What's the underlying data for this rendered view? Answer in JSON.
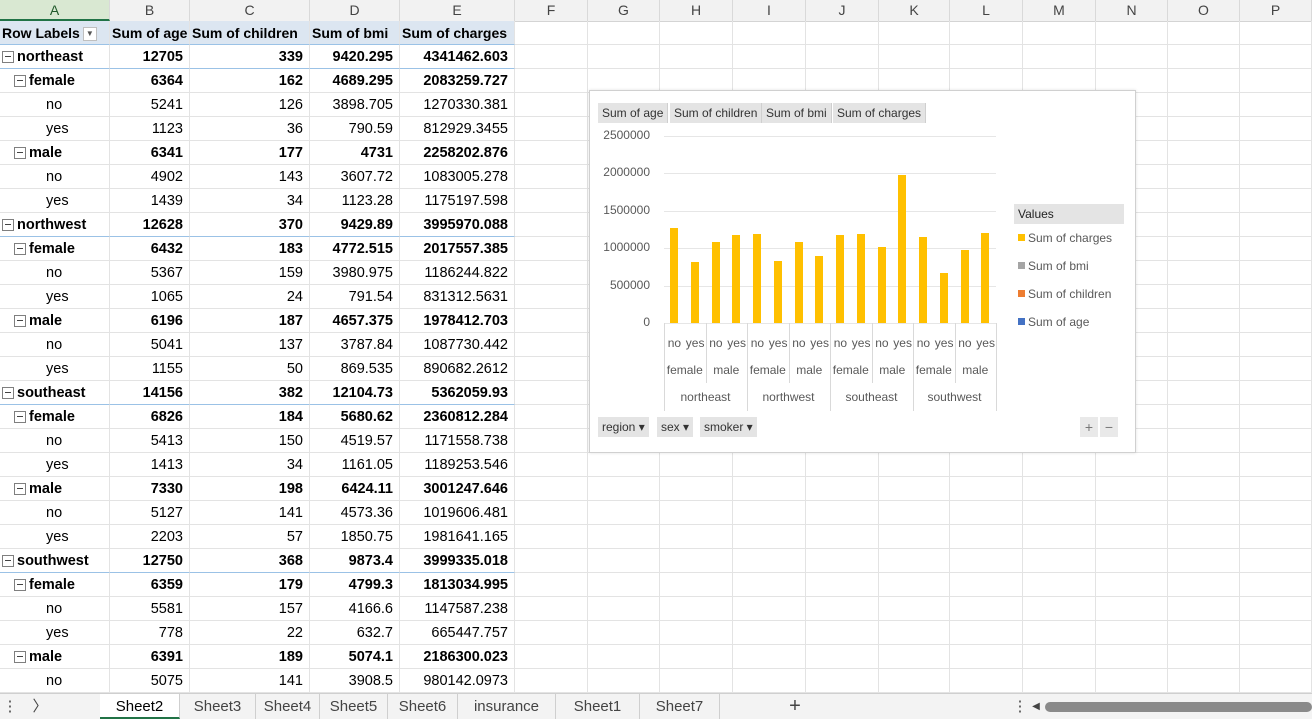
{
  "columns": [
    "A",
    "B",
    "C",
    "D",
    "E",
    "F",
    "G",
    "H",
    "I",
    "J",
    "K",
    "L",
    "M",
    "N",
    "O",
    "P"
  ],
  "pivot": {
    "headers": [
      "Row Labels",
      "Sum of age",
      "Sum of children",
      "Sum of bmi",
      "Sum of charges"
    ],
    "rows": [
      {
        "level": 0,
        "label": "northeast",
        "age": "12705",
        "children": "339",
        "bmi": "9420.295",
        "charges": "4341462.603"
      },
      {
        "level": 1,
        "label": "female",
        "age": "6364",
        "children": "162",
        "bmi": "4689.295",
        "charges": "2083259.727"
      },
      {
        "level": 2,
        "label": "no",
        "age": "5241",
        "children": "126",
        "bmi": "3898.705",
        "charges": "1270330.381"
      },
      {
        "level": 2,
        "label": "yes",
        "age": "1123",
        "children": "36",
        "bmi": "790.59",
        "charges": "812929.3455"
      },
      {
        "level": 1,
        "label": "male",
        "age": "6341",
        "children": "177",
        "bmi": "4731",
        "charges": "2258202.876"
      },
      {
        "level": 2,
        "label": "no",
        "age": "4902",
        "children": "143",
        "bmi": "3607.72",
        "charges": "1083005.278"
      },
      {
        "level": 2,
        "label": "yes",
        "age": "1439",
        "children": "34",
        "bmi": "1123.28",
        "charges": "1175197.598"
      },
      {
        "level": 0,
        "label": "northwest",
        "age": "12628",
        "children": "370",
        "bmi": "9429.89",
        "charges": "3995970.088"
      },
      {
        "level": 1,
        "label": "female",
        "age": "6432",
        "children": "183",
        "bmi": "4772.515",
        "charges": "2017557.385"
      },
      {
        "level": 2,
        "label": "no",
        "age": "5367",
        "children": "159",
        "bmi": "3980.975",
        "charges": "1186244.822"
      },
      {
        "level": 2,
        "label": "yes",
        "age": "1065",
        "children": "24",
        "bmi": "791.54",
        "charges": "831312.5631"
      },
      {
        "level": 1,
        "label": "male",
        "age": "6196",
        "children": "187",
        "bmi": "4657.375",
        "charges": "1978412.703"
      },
      {
        "level": 2,
        "label": "no",
        "age": "5041",
        "children": "137",
        "bmi": "3787.84",
        "charges": "1087730.442"
      },
      {
        "level": 2,
        "label": "yes",
        "age": "1155",
        "children": "50",
        "bmi": "869.535",
        "charges": "890682.2612"
      },
      {
        "level": 0,
        "label": "southeast",
        "age": "14156",
        "children": "382",
        "bmi": "12104.73",
        "charges": "5362059.93"
      },
      {
        "level": 1,
        "label": "female",
        "age": "6826",
        "children": "184",
        "bmi": "5680.62",
        "charges": "2360812.284"
      },
      {
        "level": 2,
        "label": "no",
        "age": "5413",
        "children": "150",
        "bmi": "4519.57",
        "charges": "1171558.738"
      },
      {
        "level": 2,
        "label": "yes",
        "age": "1413",
        "children": "34",
        "bmi": "1161.05",
        "charges": "1189253.546"
      },
      {
        "level": 1,
        "label": "male",
        "age": "7330",
        "children": "198",
        "bmi": "6424.11",
        "charges": "3001247.646"
      },
      {
        "level": 2,
        "label": "no",
        "age": "5127",
        "children": "141",
        "bmi": "4573.36",
        "charges": "1019606.481"
      },
      {
        "level": 2,
        "label": "yes",
        "age": "2203",
        "children": "57",
        "bmi": "1850.75",
        "charges": "1981641.165"
      },
      {
        "level": 0,
        "label": "southwest",
        "age": "12750",
        "children": "368",
        "bmi": "9873.4",
        "charges": "3999335.018"
      },
      {
        "level": 1,
        "label": "female",
        "age": "6359",
        "children": "179",
        "bmi": "4799.3",
        "charges": "1813034.995"
      },
      {
        "level": 2,
        "label": "no",
        "age": "5581",
        "children": "157",
        "bmi": "4166.6",
        "charges": "1147587.238"
      },
      {
        "level": 2,
        "label": "yes",
        "age": "778",
        "children": "22",
        "bmi": "632.7",
        "charges": "665447.757"
      },
      {
        "level": 1,
        "label": "male",
        "age": "6391",
        "children": "189",
        "bmi": "5074.1",
        "charges": "2186300.023"
      },
      {
        "level": 2,
        "label": "no",
        "age": "5075",
        "children": "141",
        "bmi": "3908.5",
        "charges": "980142.0973"
      }
    ]
  },
  "chart": {
    "field_buttons": [
      "Sum of age",
      "Sum of children",
      "Sum of bmi",
      "Sum of charges"
    ],
    "axis_buttons": [
      "region",
      "sex",
      "smoker"
    ],
    "plus_label": "+",
    "minus_label": "−",
    "dropdown_icon": "caret-down-icon",
    "legend_title": "Values",
    "legend": [
      {
        "name": "Sum of charges",
        "color": "#ffc000"
      },
      {
        "name": "Sum of bmi",
        "color": "#a5a5a5"
      },
      {
        "name": "Sum of children",
        "color": "#ed7d31"
      },
      {
        "name": "Sum of age",
        "color": "#4472c4"
      }
    ]
  },
  "chart_data": {
    "type": "bar",
    "ylim": [
      0,
      2500000
    ],
    "yticks": [
      "0",
      "500000",
      "1000000",
      "1500000",
      "2000000",
      "2500000"
    ],
    "grid": true,
    "legend_position": "right",
    "x_levels": {
      "smoker": [
        "no",
        "yes",
        "no",
        "yes",
        "no",
        "yes",
        "no",
        "yes",
        "no",
        "yes",
        "no",
        "yes",
        "no",
        "yes",
        "no",
        "yes"
      ],
      "sex": [
        "female",
        "male",
        "female",
        "male",
        "female",
        "male",
        "female",
        "male"
      ],
      "region": [
        "northeast",
        "northwest",
        "southeast",
        "southwest"
      ]
    },
    "series": [
      {
        "name": "Sum of charges",
        "color": "#ffc000",
        "values": [
          1270330.381,
          812929.3455,
          1083005.278,
          1175197.598,
          1186244.822,
          831312.5631,
          1087730.442,
          890682.2612,
          1171558.738,
          1189253.546,
          1019606.481,
          1981641.165,
          1147587.238,
          665447.757,
          980142.0973,
          1206158.0
        ]
      },
      {
        "name": "Sum of bmi",
        "color": "#a5a5a5",
        "values": [
          3898.705,
          790.59,
          3607.72,
          1123.28,
          3980.975,
          791.54,
          3787.84,
          869.535,
          4519.57,
          1161.05,
          4573.36,
          1850.75,
          4166.6,
          632.7,
          3908.5,
          1165.6
        ]
      },
      {
        "name": "Sum of children",
        "color": "#ed7d31",
        "values": [
          126,
          36,
          143,
          34,
          159,
          24,
          137,
          50,
          150,
          34,
          141,
          57,
          157,
          22,
          141,
          48
        ]
      },
      {
        "name": "Sum of age",
        "color": "#4472c4",
        "values": [
          5241,
          1123,
          4902,
          1439,
          5367,
          1065,
          5041,
          1155,
          5413,
          1413,
          5127,
          2203,
          5581,
          778,
          5075,
          1316
        ]
      }
    ]
  },
  "sheet_tabs": [
    "Sheet2",
    "Sheet3",
    "Sheet4",
    "Sheet5",
    "Sheet6",
    "insurance",
    "Sheet1",
    "Sheet7"
  ],
  "active_tab": "Sheet2",
  "add_sheet_label": "+",
  "nav_prev_label": "〉",
  "more_label": "⋮",
  "scroll_left_label": "◀"
}
